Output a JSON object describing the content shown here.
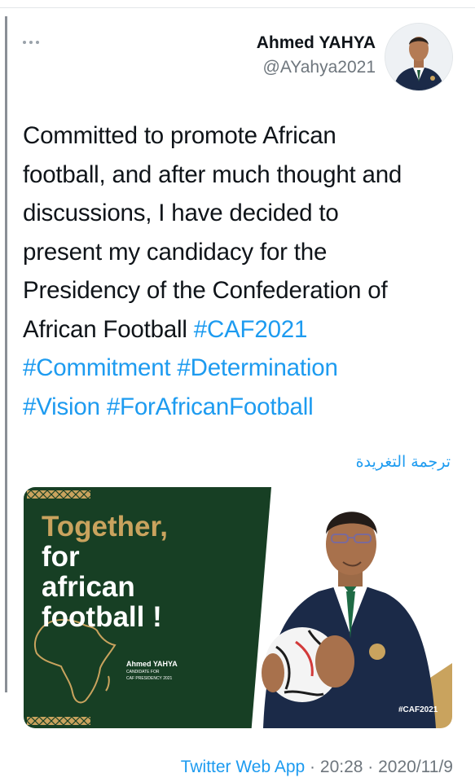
{
  "author": {
    "name": "Ahmed YAHYA",
    "handle": "@AYahya2021"
  },
  "more_menu": {
    "icon": "more-horizontal-icon"
  },
  "tweet": {
    "lines": [
      "Committed to promote African",
      "football, and after much thought and",
      "discussions, I have decided to",
      "present my candidacy for the",
      "Presidency of the Confederation of"
    ],
    "line6_text": "African Football ",
    "hashtags": [
      "#CAF2021",
      "#Commitment",
      "#Determination",
      "#Vision",
      "#ForAfricanFootball"
    ]
  },
  "translate_label": "ترجمة التغريدة",
  "media": {
    "headline_gold": "Together,",
    "headline_lines": [
      "for",
      "african",
      "football !"
    ],
    "candidate_name": "Ahmed YAHYA",
    "candidate_sub1": "CANDIDATE FOR",
    "candidate_sub2": "CAF PRESIDENCY 2021",
    "badge": "#CAF2021",
    "colors": {
      "green": "#173f24",
      "gold": "#c9a35e"
    }
  },
  "meta": {
    "source": "Twitter Web App",
    "separator": " · ",
    "time": "20:28",
    "date": "2020/11/9"
  }
}
